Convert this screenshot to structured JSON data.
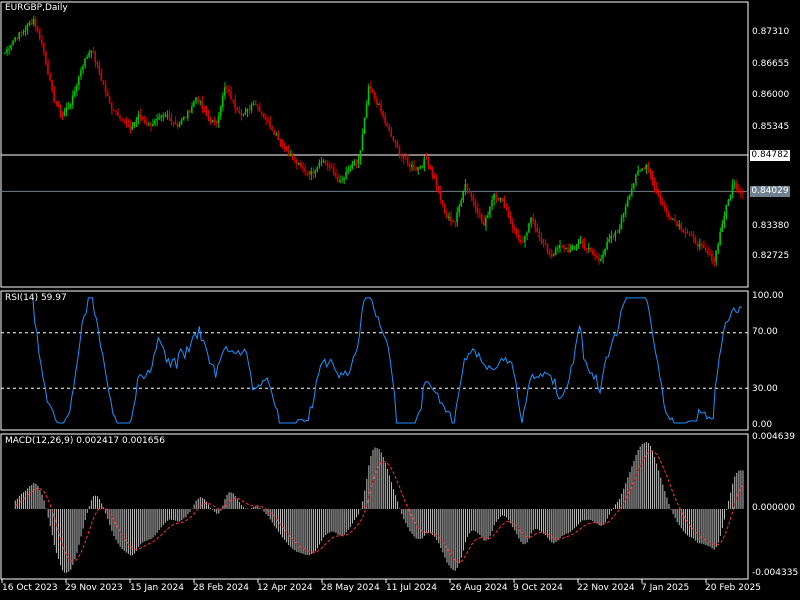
{
  "panels": {
    "main": {
      "title": "EURGBP,Daily"
    },
    "rsi": {
      "title": "RSI(14) 59.97"
    },
    "macd": {
      "title": "MACD(12,26,9) 0.002417 0.001656"
    }
  },
  "price_axis": [
    "0.87310",
    "0.86655",
    "0.86000",
    "0.85345",
    "0.84782",
    "0.84029",
    "0.83380",
    "0.82725"
  ],
  "rsi_axis": [
    "100.00",
    "70.00",
    "30.00",
    "0.00"
  ],
  "macd_axis": [
    "0.004639",
    "0.000000",
    "-0.004335"
  ],
  "time_axis": [
    "16 Oct 2023",
    "29 Nov 2023",
    "15 Jan 2024",
    "28 Feb 2024",
    "12 Apr 2024",
    "28 May 2024",
    "11 Jul 2024",
    "26 Aug 2024",
    "9 Oct 2024",
    "22 Nov 2024",
    "7 Jan 2025",
    "20 Feb 2025"
  ],
  "colors": {
    "bull": "#00c800",
    "bear": "#e00000",
    "rsi": "#1e90ff",
    "hist": "#c0c0c0",
    "signal": "#ff3030",
    "grid": "#ffffff"
  },
  "chart_data": [
    {
      "type": "candlestick",
      "title": "EURGBP,Daily",
      "ylim": [
        0.8205,
        0.8795
      ],
      "x_range": [
        "16 Oct 2023",
        "13 Mar 2025"
      ],
      "approx_close": [
        0.869,
        0.872,
        0.8735,
        0.876,
        0.87,
        0.86,
        0.856,
        0.859,
        0.866,
        0.87,
        0.864,
        0.858,
        0.856,
        0.853,
        0.856,
        0.854,
        0.855,
        0.856,
        0.854,
        0.856,
        0.86,
        0.856,
        0.854,
        0.862,
        0.858,
        0.856,
        0.859,
        0.856,
        0.853,
        0.85,
        0.847,
        0.845,
        0.844,
        0.847,
        0.845,
        0.842,
        0.845,
        0.847,
        0.862,
        0.858,
        0.853,
        0.849,
        0.846,
        0.845,
        0.847,
        0.842,
        0.835,
        0.834,
        0.842,
        0.838,
        0.833,
        0.84,
        0.838,
        0.833,
        0.829,
        0.835,
        0.83,
        0.827,
        0.829,
        0.828,
        0.83,
        0.828,
        0.826,
        0.83,
        0.832,
        0.839,
        0.844,
        0.846,
        0.84,
        0.836,
        0.834,
        0.832,
        0.83,
        0.828,
        0.826,
        0.835,
        0.842,
        0.84
      ],
      "last_price": 0.84029,
      "hline": 0.84782
    },
    {
      "type": "line",
      "title": "RSI(14) 59.97",
      "ylim": [
        0,
        100
      ],
      "levels": [
        30,
        70
      ],
      "last": 59.97
    },
    {
      "type": "bar",
      "title": "MACD(12,26,9) 0.002417 0.001656",
      "ylim": [
        -0.004335,
        0.004639
      ],
      "macd_last": 0.002417,
      "signal_last": 0.001656
    }
  ]
}
